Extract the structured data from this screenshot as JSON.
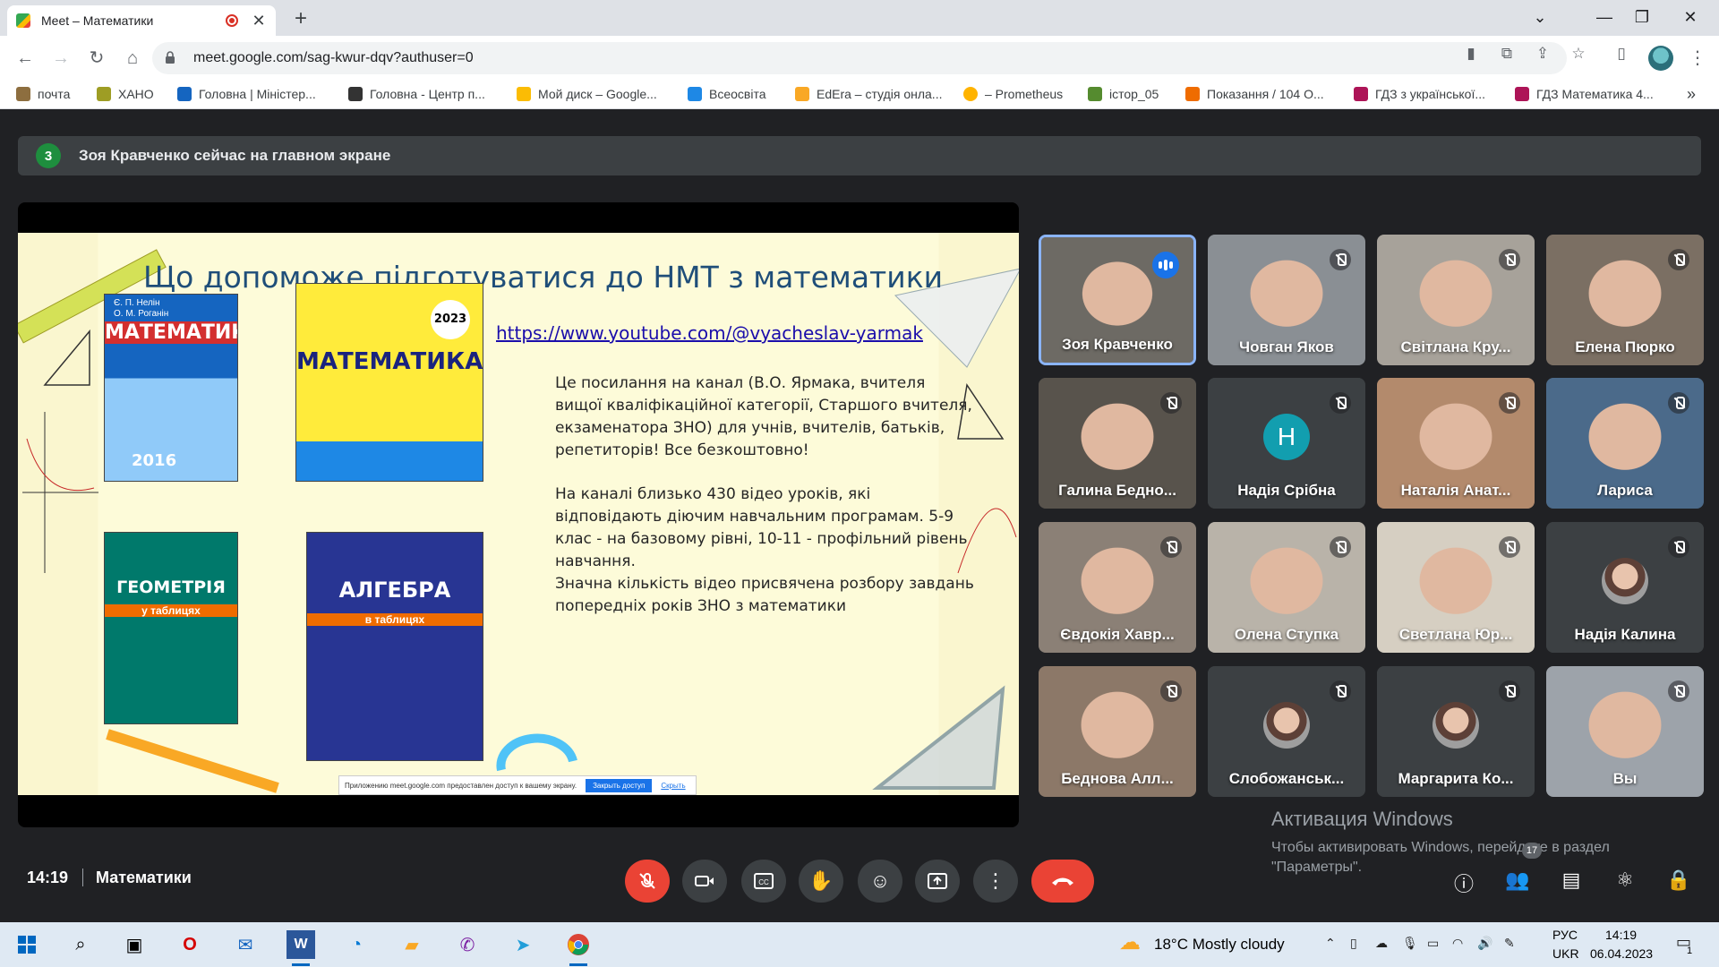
{
  "browser": {
    "tab_title": "Meet – Математики",
    "url": "meet.google.com/sag-kwur-dqv?authuser=0",
    "bookmarks": [
      {
        "label": "почта",
        "color": "#8d6e3f"
      },
      {
        "label": "ХАНО",
        "color": "#9e9d24"
      },
      {
        "label": "Головна | Міністер...",
        "color": "#1565c0"
      },
      {
        "label": "Головна - Центр п...",
        "color": "#333333"
      },
      {
        "label": "Мой диск – Google...",
        "color": "#fbbc04"
      },
      {
        "label": "Всеосвіта",
        "color": "#1e88e5"
      },
      {
        "label": "EdEra – студія онла...",
        "color": "#f9a825"
      },
      {
        "label": "– Prometheus",
        "color": "#ffb300"
      },
      {
        "label": "істор_05",
        "color": "#558b2f"
      },
      {
        "label": "Показання / 104 О...",
        "color": "#ef6c00"
      },
      {
        "label": "ГДЗ з української...",
        "color": "#ad1457"
      },
      {
        "label": "ГДЗ Математика 4...",
        "color": "#ad1457"
      }
    ],
    "bookmarks_more": "»"
  },
  "meet": {
    "banner_count": "3",
    "banner_text": "Зоя Кравченко сейчас на главном экране",
    "time": "14:19",
    "meeting_name": "Математики",
    "people_count": "17",
    "participants": [
      {
        "name": "Зоя Кравченко",
        "state": "speaking",
        "bg": "#6d6a64"
      },
      {
        "name": "Човган Яков",
        "state": "muted",
        "bg": "#8a8f94"
      },
      {
        "name": "Світлана Кру...",
        "state": "muted",
        "bg": "#a7a29a"
      },
      {
        "name": "Елена Пюрко",
        "state": "muted",
        "bg": "#7b6f63"
      },
      {
        "name": "Галина Бедно...",
        "state": "muted",
        "bg": "#58534c"
      },
      {
        "name": "Надія Срібна",
        "state": "muted",
        "bg": "#3c4043",
        "letter": "Н"
      },
      {
        "name": "Наталія Анат...",
        "state": "muted",
        "bg": "#b38a6c"
      },
      {
        "name": "Лариса",
        "state": "muted",
        "bg": "#4b6a8a"
      },
      {
        "name": "Євдокія Хавр...",
        "state": "muted",
        "bg": "#8b8076"
      },
      {
        "name": "Олена Ступка",
        "state": "muted",
        "bg": "#b9b3a9"
      },
      {
        "name": "Светлана Юр...",
        "state": "muted",
        "bg": "#d6cfc2"
      },
      {
        "name": "Надія Калина",
        "state": "muted",
        "bg": "#3c4043",
        "avatar": true
      },
      {
        "name": "Беднова Алл...",
        "state": "muted",
        "bg": "#8c7868"
      },
      {
        "name": "Слобожанськ...",
        "state": "muted",
        "bg": "#3c4043",
        "avatar": true
      },
      {
        "name": "Маргарита Ко...",
        "state": "muted",
        "bg": "#3c4043",
        "avatar": true
      },
      {
        "name": "Вы",
        "state": "muted",
        "bg": "#9da3aa"
      }
    ]
  },
  "slide": {
    "title": "Що допоможе підготуватися до НМТ з математики",
    "link": "https://www.youtube.com/@vyacheslav-yarmak",
    "para1": "Це посилання на канал (В.О. Ярмака, вчителя вищої кваліфікаційної категорії, Старшого вчителя, екзаменатора ЗНО) для учнів, вчителів, батьків, репетиторів! Все безкоштовно!",
    "para2": "На каналі близько 430 відео уроків, які відповідають діючим  навчальним програмам. 5-9 клас - на базовому рівні, 10-11 - профільний рівень навчання.",
    "para3": "Значна кількість відео присвячена розбору завдань попередніх років ЗНО з математики",
    "book1_author": "Є. П. Нелін\nО. М. Роганін",
    "book1_title": "МАТЕМАТИКА",
    "book1_year": "2016",
    "book2_title": "МАТЕМАТИКА",
    "book2_year": "2023",
    "book3_title": "ГЕОМЕТРІЯ",
    "book3_sub": "у таблицях",
    "book4_title": "АЛГЕБРА",
    "book4_sub": "в таблицях",
    "share_notice": "Приложению meet.google.com предоставлен доступ к вашему экрану.",
    "share_stop": "Закрыть доступ",
    "share_hide": "Скрыть"
  },
  "windows_activation": {
    "title": "Активация Windows",
    "line1": "Чтобы активировать Windows, перейдите в раздел",
    "line2": "\"Параметры\"."
  },
  "taskbar": {
    "weather": "18°C  Mostly cloudy",
    "lang_top": "РУС",
    "lang_bottom": "UKR",
    "clock_time": "14:19",
    "clock_date": "06.04.2023",
    "notifications": "1"
  },
  "colors": {
    "end_call": "#ea4335",
    "mic_off": "#ea4335",
    "active_border": "#8ab4f8",
    "slide_title": "#1f4e79"
  }
}
